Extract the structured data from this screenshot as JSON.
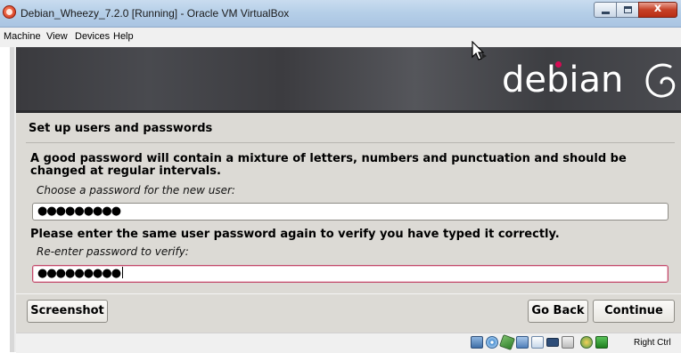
{
  "window": {
    "title": "Debian_Wheezy_7.2.0 [Running] - Oracle VM VirtualBox",
    "close_glyph": "x"
  },
  "menu": [
    "Machine",
    "View",
    "Devices",
    "Help"
  ],
  "banner": {
    "logo_text": "debian"
  },
  "installer": {
    "section_title": "Set up users and passwords",
    "help_text": "A good password will contain a mixture of letters, numbers and punctuation and should be changed at regular intervals.",
    "prompt_password": "Choose a password for the new user:",
    "password_value": "●●●●●●●●●",
    "verify_help": "Please enter the same user password again to verify you have typed it correctly.",
    "prompt_verify": "Re-enter password to verify:",
    "verify_value": "●●●●●●●●●",
    "buttons": {
      "screenshot": "Screenshot",
      "go_back": "Go Back",
      "continue": "Continue"
    }
  },
  "statusbar": {
    "icons": [
      "hard-disk-icon",
      "optical-drive-icon",
      "usb-icon",
      "network-icon",
      "shared-folders-icon",
      "display-icon",
      "capture-icon",
      "mouse-integration-icon",
      "keyboard-capture-icon"
    ],
    "host_key": "Right Ctrl"
  },
  "colors": {
    "debian_red": "#d70a53",
    "banner": "#46474b",
    "installer_bg": "#dcdad5"
  }
}
